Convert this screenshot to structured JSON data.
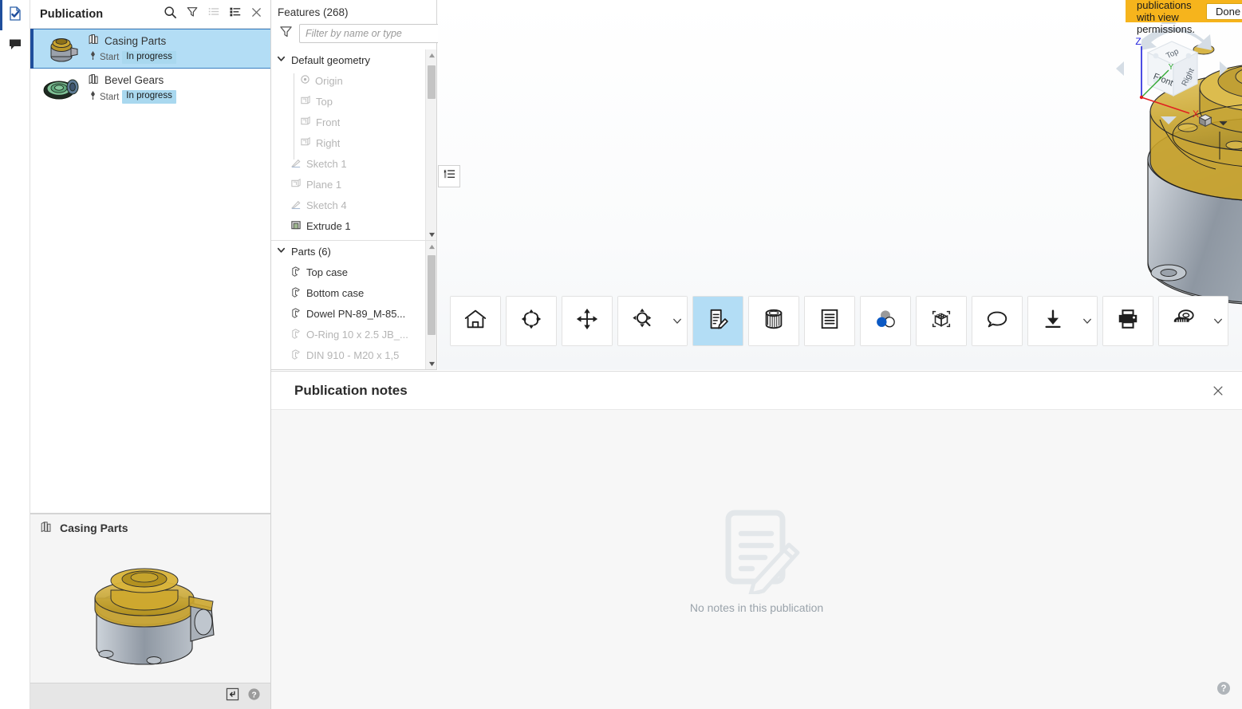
{
  "rail": {
    "items": [
      {
        "name": "publication-check-icon",
        "icon": "document-check-icon"
      },
      {
        "name": "comments-icon",
        "icon": "speech-bubble-icon"
      }
    ]
  },
  "publication_panel": {
    "title": "Publication",
    "header_icons": [
      {
        "name": "search-icon",
        "label": "Search"
      },
      {
        "name": "filter-icon",
        "label": "Filter"
      },
      {
        "name": "list-view-icon",
        "label": "List view"
      },
      {
        "name": "detail-view-icon",
        "label": "Detail view"
      },
      {
        "name": "close-icon",
        "label": "Close"
      }
    ],
    "items": [
      {
        "name": "Casing Parts",
        "state_label": "Start",
        "status": "In progress",
        "selected": true
      },
      {
        "name": "Bevel Gears",
        "state_label": "Start",
        "status": "In progress",
        "selected": false
      }
    ],
    "preview": {
      "title": "Casing Parts",
      "footer_icons": [
        {
          "name": "open-in-panel-icon"
        },
        {
          "name": "help-icon"
        }
      ]
    }
  },
  "features_panel": {
    "title": "Features (268)",
    "filter": {
      "placeholder": "Filter by name or type",
      "value": ""
    },
    "tree_top": [
      {
        "label": "Default geometry",
        "icon": "chevron-down-icon",
        "level": 0,
        "dim": false
      },
      {
        "label": "Origin",
        "icon": "origin-icon",
        "level": 2,
        "dim": true
      },
      {
        "label": "Top",
        "icon": "plane-icon",
        "level": 2,
        "dim": true
      },
      {
        "label": "Front",
        "icon": "plane-icon",
        "level": 2,
        "dim": true
      },
      {
        "label": "Right",
        "icon": "plane-icon",
        "level": 2,
        "dim": true
      },
      {
        "label": "Sketch 1",
        "icon": "sketch-icon",
        "level": 1,
        "dim": true
      },
      {
        "label": "Plane 1",
        "icon": "plane-icon",
        "level": 1,
        "dim": true
      },
      {
        "label": "Sketch 4",
        "icon": "sketch-icon",
        "level": 1,
        "dim": true
      },
      {
        "label": "Extrude 1",
        "icon": "extrude-icon",
        "level": 1,
        "dim": false
      }
    ],
    "tree_bottom": [
      {
        "label": "Parts (6)",
        "icon": "chevron-down-icon",
        "level": 0,
        "dim": false
      },
      {
        "label": "Top case",
        "icon": "part-icon",
        "level": 1,
        "dim": false
      },
      {
        "label": "Bottom case",
        "icon": "part-icon",
        "level": 1,
        "dim": false
      },
      {
        "label": "Dowel PN-89_M-85...",
        "icon": "part-icon",
        "level": 1,
        "dim": false
      },
      {
        "label": "O-Ring 10 x 2.5 JB_...",
        "icon": "part-icon",
        "level": 1,
        "dim": true
      },
      {
        "label": "DIN 910 - M20 x 1,5",
        "icon": "part-icon",
        "level": 1,
        "dim": true
      }
    ]
  },
  "notification": {
    "text": "Viewing publications with view permissions.",
    "button_label": "Done",
    "background": "#f6b41c"
  },
  "viewcube": {
    "faces": {
      "top": "Top",
      "front": "Front",
      "right": "Right"
    },
    "axes": {
      "x": "X",
      "y": "Y",
      "z": "Z"
    },
    "axis_colors": {
      "x": "#e02020",
      "y": "#2fa82f",
      "z": "#2222dd"
    },
    "mode_icon": "cube-icon",
    "mode_caret": "caret-down-icon"
  },
  "toolbar": {
    "groups": [
      {
        "buttons": [
          {
            "name": "home-button",
            "icon": "home-icon",
            "active": false
          }
        ]
      },
      {
        "buttons": [
          {
            "name": "rotate-button",
            "icon": "rotate-icon",
            "active": false
          }
        ]
      },
      {
        "buttons": [
          {
            "name": "pan-button",
            "icon": "pan-arrows-icon",
            "active": false
          }
        ]
      },
      {
        "buttons": [
          {
            "name": "zoom-button",
            "icon": "zoom-target-icon",
            "active": false
          }
        ],
        "caret": true
      },
      {
        "buttons": [
          {
            "name": "notes-button",
            "icon": "note-pencil-icon",
            "active": true
          }
        ]
      },
      {
        "buttons": [
          {
            "name": "section-button",
            "icon": "section-cylinder-icon",
            "active": false
          }
        ]
      },
      {
        "buttons": [
          {
            "name": "bom-button",
            "icon": "list-lines-icon",
            "active": false
          }
        ]
      },
      {
        "buttons": [
          {
            "name": "appearance-button",
            "icon": "color-circles-icon",
            "active": false
          }
        ]
      },
      {
        "buttons": [
          {
            "name": "explode-button",
            "icon": "explode-box-icon",
            "active": false
          }
        ]
      },
      {
        "buttons": [
          {
            "name": "comment-button",
            "icon": "speech-bubble-icon",
            "active": false
          }
        ]
      },
      {
        "buttons": [
          {
            "name": "download-button",
            "icon": "download-icon",
            "active": false
          }
        ],
        "caret": true
      },
      {
        "buttons": [
          {
            "name": "print-button",
            "icon": "printer-icon",
            "active": false
          }
        ]
      },
      {
        "buttons": [
          {
            "name": "measure-button",
            "icon": "measure-tape-icon",
            "active": false
          }
        ],
        "caret": true
      }
    ]
  },
  "notes_panel": {
    "title": "Publication notes",
    "close_icon": "close-icon",
    "empty_icon": "note-pencil-large-icon",
    "empty_text": "No notes in this publication"
  },
  "help": {
    "icon": "help-icon"
  },
  "panel_toggle": {
    "icon": "expand-tree-icon"
  },
  "colors": {
    "accent_blue": "#1f4e9c",
    "selection_blue": "#b3ddf5",
    "warning_yellow": "#f6b41c",
    "model_gold": "#c9a227",
    "model_grey": "#9aa3ad"
  }
}
